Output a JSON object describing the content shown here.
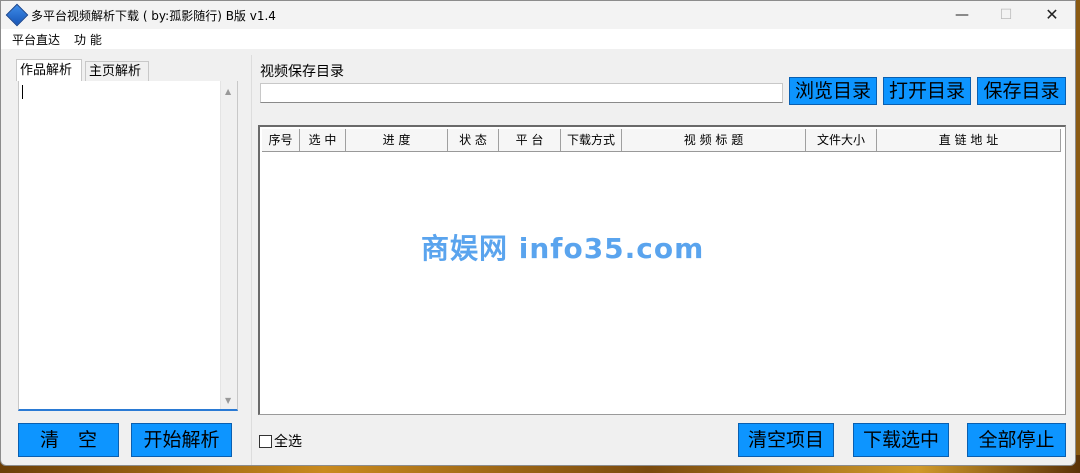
{
  "window": {
    "title": "多平台视频解析下载 ( by:孤影随行) B版 v1.4",
    "min_glyph": "—",
    "max_glyph": "☐",
    "close_glyph": "✕"
  },
  "menu": {
    "items": [
      "平台直达",
      "功 能"
    ]
  },
  "left": {
    "tabs": [
      "作品解析",
      "主页解析"
    ],
    "clear_label": "清　空",
    "start_label": "开始解析"
  },
  "right": {
    "dir_label": "视频保存目录",
    "dir_value": "",
    "browse_label": "浏览目录",
    "open_label": "打开目录",
    "save_label": "保存目录",
    "columns": [
      "序号",
      "选 中",
      "进 度",
      "状 态",
      "平 台",
      "下载方式",
      "视 频 标 题",
      "文件大小",
      "直 链 地 址"
    ],
    "select_all_label": "全选",
    "clear_items_label": "清空项目",
    "download_selected_label": "下载选中",
    "stop_all_label": "全部停止"
  },
  "watermark": "商娱网 info35.com",
  "colors": {
    "button_blue": "#0d95ff",
    "watermark": "#5aa4ee"
  }
}
